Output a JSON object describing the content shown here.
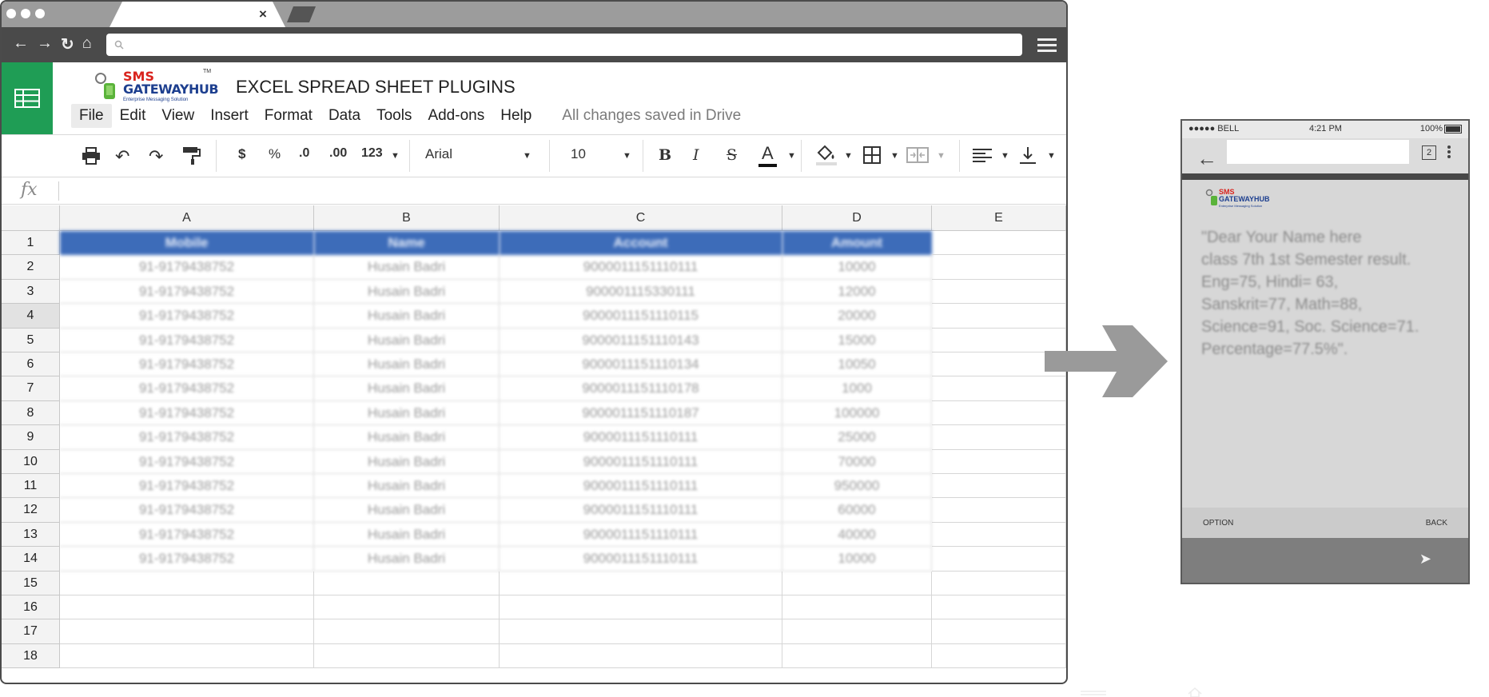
{
  "browser": {
    "tab_close": "×",
    "nav": {
      "back": "←",
      "forward": "→",
      "reload": "↻",
      "home": "⌂"
    },
    "url_placeholder": ""
  },
  "sheets": {
    "brand": {
      "line1": "SMS",
      "line2": "GATEWAYHUB",
      "tagline": "Enterprise Messaging Solution",
      "tm": "TM"
    },
    "doc_title": "EXCEL SPREAD SHEET PLUGINS",
    "menu": [
      "File",
      "Edit",
      "View",
      "Insert",
      "Format",
      "Data",
      "Tools",
      "Add-ons",
      "Help"
    ],
    "saved_status": "All changes saved in Drive",
    "toolbar": {
      "currency": "$",
      "percent": "%",
      "dec_decrease": ".0",
      "dec_increase": ".00",
      "number_format": "123",
      "font": "Arial",
      "font_size": "10",
      "bold": "B",
      "italic": "I",
      "strike": "S",
      "text_color": "A"
    },
    "fx_label": "fx",
    "columns": [
      "A",
      "B",
      "C",
      "D",
      "E"
    ],
    "row_numbers": [
      "1",
      "2",
      "3",
      "4",
      "5",
      "6",
      "7",
      "8",
      "9",
      "10",
      "11",
      "12",
      "13",
      "14",
      "15",
      "16",
      "17",
      "18"
    ],
    "header_row": [
      "Mobile",
      "Name",
      "Account",
      "Amount"
    ],
    "rows": [
      [
        "91-9179438752",
        "Husain Badri",
        "9000011151110111",
        "10000"
      ],
      [
        "91-9179438752",
        "Husain Badri",
        "900001115330111",
        "12000"
      ],
      [
        "91-9179438752",
        "Husain Badri",
        "9000011151110115",
        "20000"
      ],
      [
        "91-9179438752",
        "Husain Badri",
        "9000011151110143",
        "15000"
      ],
      [
        "91-9179438752",
        "Husain Badri",
        "9000011151110134",
        "10050"
      ],
      [
        "91-9179438752",
        "Husain Badri",
        "9000011151110178",
        "1000"
      ],
      [
        "91-9179438752",
        "Husain Badri",
        "9000011151110187",
        "100000"
      ],
      [
        "91-9179438752",
        "Husain Badri",
        "9000011151110111",
        "25000"
      ],
      [
        "91-9179438752",
        "Husain Badri",
        "9000011151110111",
        "70000"
      ],
      [
        "91-9179438752",
        "Husain Badri",
        "9000011151110111",
        "950000"
      ],
      [
        "91-9179438752",
        "Husain Badri",
        "9000011151110111",
        "60000"
      ],
      [
        "91-9179438752",
        "Husain Badri",
        "9000011151110111",
        "40000"
      ],
      [
        "91-9179438752",
        "Husain Badri",
        "9000011151110111",
        "10000"
      ]
    ]
  },
  "phone": {
    "carrier": "●●●●● BELL",
    "time": "4:21 PM",
    "battery": "100%",
    "tab_count": "2",
    "brand": {
      "line1": "SMS",
      "line2": "GATEWAYHUB",
      "tagline": "Enterprise Messaging Solution"
    },
    "message": "\"Dear   Your Name here\nclass 7th 1st Semester result.\nEng=75, Hindi= 63,\nSanskrit=77, Math=88,\nScience=91, Soc. Science=71.\nPercentage=77.5%\".",
    "option": "OPTION",
    "back": "BACK",
    "send": "➤"
  },
  "colors": {
    "sheets_green": "#1f9d55",
    "header_blue": "#3d6cb9",
    "browser_dark": "#4a4a4a",
    "arrow_gray": "#9a9a9a"
  }
}
